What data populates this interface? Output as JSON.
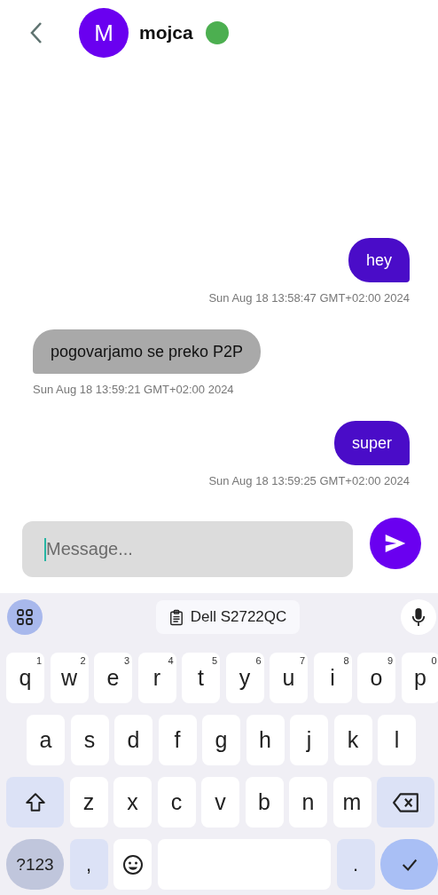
{
  "header": {
    "avatar_letter": "M",
    "name": "mojca",
    "online": true
  },
  "messages": [
    {
      "kind": "sent",
      "text": "hey",
      "time": "Sun Aug 18 13:58:47 GMT+02:00 2024"
    },
    {
      "kind": "received",
      "text": "pogovarjamo se preko P2P",
      "time": "Sun Aug 18 13:59:21 GMT+02:00 2024"
    },
    {
      "kind": "sent",
      "text": "super",
      "time": "Sun Aug 18 13:59:25 GMT+02:00 2024"
    }
  ],
  "composer": {
    "placeholder": "Message..."
  },
  "keyboard": {
    "clipboard_suggestion": "Dell S2722QC",
    "rows": [
      {
        "keys": [
          {
            "kind": "char",
            "label": "q",
            "hint": "1"
          },
          {
            "kind": "char",
            "label": "w",
            "hint": "2"
          },
          {
            "kind": "char",
            "label": "e",
            "hint": "3"
          },
          {
            "kind": "char",
            "label": "r",
            "hint": "4"
          },
          {
            "kind": "char",
            "label": "t",
            "hint": "5"
          },
          {
            "kind": "char",
            "label": "y",
            "hint": "6"
          },
          {
            "kind": "char",
            "label": "u",
            "hint": "7"
          },
          {
            "kind": "char",
            "label": "i",
            "hint": "8"
          },
          {
            "kind": "char",
            "label": "o",
            "hint": "9"
          },
          {
            "kind": "char",
            "label": "p",
            "hint": "0"
          }
        ]
      },
      {
        "keys": [
          {
            "kind": "char",
            "label": "a"
          },
          {
            "kind": "char",
            "label": "s"
          },
          {
            "kind": "char",
            "label": "d"
          },
          {
            "kind": "char",
            "label": "f"
          },
          {
            "kind": "char",
            "label": "g"
          },
          {
            "kind": "char",
            "label": "h"
          },
          {
            "kind": "char",
            "label": "j"
          },
          {
            "kind": "char",
            "label": "k"
          },
          {
            "kind": "char",
            "label": "l"
          }
        ]
      },
      {
        "keys": [
          {
            "kind": "shift"
          },
          {
            "kind": "char",
            "label": "z"
          },
          {
            "kind": "char",
            "label": "x"
          },
          {
            "kind": "char",
            "label": "c"
          },
          {
            "kind": "char",
            "label": "v"
          },
          {
            "kind": "char",
            "label": "b"
          },
          {
            "kind": "char",
            "label": "n"
          },
          {
            "kind": "char",
            "label": "m"
          },
          {
            "kind": "backspace"
          }
        ]
      },
      {
        "keys": [
          {
            "kind": "symbols",
            "label": "?123"
          },
          {
            "kind": "punct",
            "label": ","
          },
          {
            "kind": "emoji"
          },
          {
            "kind": "space"
          },
          {
            "kind": "punct",
            "label": "."
          },
          {
            "kind": "enter"
          }
        ]
      }
    ]
  }
}
